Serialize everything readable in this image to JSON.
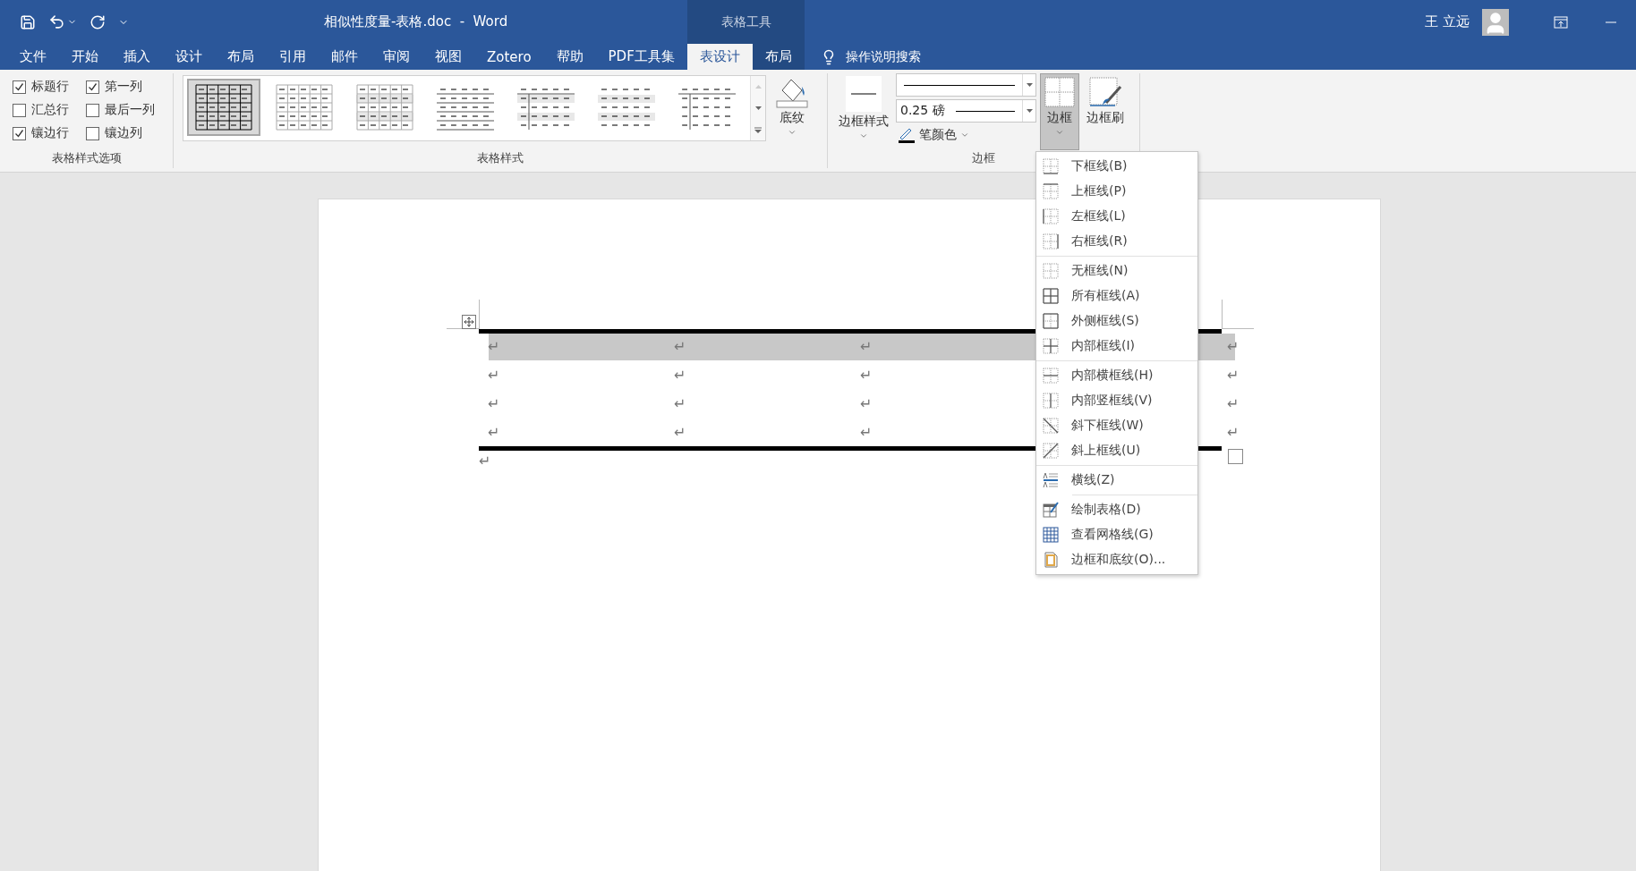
{
  "title_bar": {
    "document_title": "相似性度量-表格.doc  -  Word",
    "context_header": "表格工具",
    "user_name": "王 立远"
  },
  "ribbon_tabs": [
    {
      "label": "文件",
      "selected": false,
      "contextual": false
    },
    {
      "label": "开始",
      "selected": false,
      "contextual": false
    },
    {
      "label": "插入",
      "selected": false,
      "contextual": false
    },
    {
      "label": "设计",
      "selected": false,
      "contextual": false
    },
    {
      "label": "布局",
      "selected": false,
      "contextual": false
    },
    {
      "label": "引用",
      "selected": false,
      "contextual": false
    },
    {
      "label": "邮件",
      "selected": false,
      "contextual": false
    },
    {
      "label": "审阅",
      "selected": false,
      "contextual": false
    },
    {
      "label": "视图",
      "selected": false,
      "contextual": false
    },
    {
      "label": "Zotero",
      "selected": false,
      "contextual": false
    },
    {
      "label": "帮助",
      "selected": false,
      "contextual": false
    },
    {
      "label": "PDF工具集",
      "selected": false,
      "contextual": false
    },
    {
      "label": "表设计",
      "selected": true,
      "contextual": true
    },
    {
      "label": "布局",
      "selected": false,
      "contextual": true
    }
  ],
  "tell_me": {
    "placeholder": "操作说明搜索"
  },
  "ribbon": {
    "style_options": {
      "label": "表格样式选项",
      "options": [
        {
          "label": "标题行",
          "checked": true
        },
        {
          "label": "第一列",
          "checked": true
        },
        {
          "label": "汇总行",
          "checked": false
        },
        {
          "label": "最后一列",
          "checked": false
        },
        {
          "label": "镶边行",
          "checked": true
        },
        {
          "label": "镶边列",
          "checked": false
        }
      ]
    },
    "table_styles": {
      "label": "表格样式",
      "shading": "底纹",
      "styles": [
        {
          "selected": true
        },
        {
          "selected": false
        },
        {
          "selected": false
        },
        {
          "selected": false
        },
        {
          "selected": false
        },
        {
          "selected": false
        },
        {
          "selected": false
        }
      ]
    },
    "borders": {
      "label": "边框",
      "border_styles": "边框样式",
      "weight": "0.25 磅",
      "pen_color": "笔颜色",
      "borders_button": {
        "label": "边框",
        "pressed": true
      },
      "border_painter": "边框刷"
    }
  },
  "document": {
    "table": {
      "rows": [
        {
          "selected": true,
          "cells": [
            "↵",
            "↵",
            "↵"
          ],
          "end_mark": "↵"
        },
        {
          "selected": false,
          "cells": [
            "↵",
            "↵",
            "↵"
          ],
          "end_mark": "↵"
        },
        {
          "selected": false,
          "cells": [
            "↵",
            "↵",
            "↵"
          ],
          "end_mark": "↵"
        },
        {
          "selected": false,
          "cells": [
            "↵",
            "↵",
            "↵"
          ],
          "end_mark": "↵"
        }
      ]
    },
    "paragraph_mark": "↵"
  },
  "borders_menu": {
    "groups": [
      [
        "下框线(B)",
        "上框线(P)",
        "左框线(L)",
        "右框线(R)"
      ],
      [
        "无框线(N)",
        "所有框线(A)",
        "外侧框线(S)",
        "内部框线(I)"
      ],
      [
        "内部横框线(H)",
        "内部竖框线(V)",
        "斜下框线(W)",
        "斜上框线(U)"
      ],
      [
        "横线(Z)"
      ],
      [
        "绘制表格(D)",
        "查看网格线(G)",
        "边框和底纹(O)..."
      ]
    ]
  }
}
